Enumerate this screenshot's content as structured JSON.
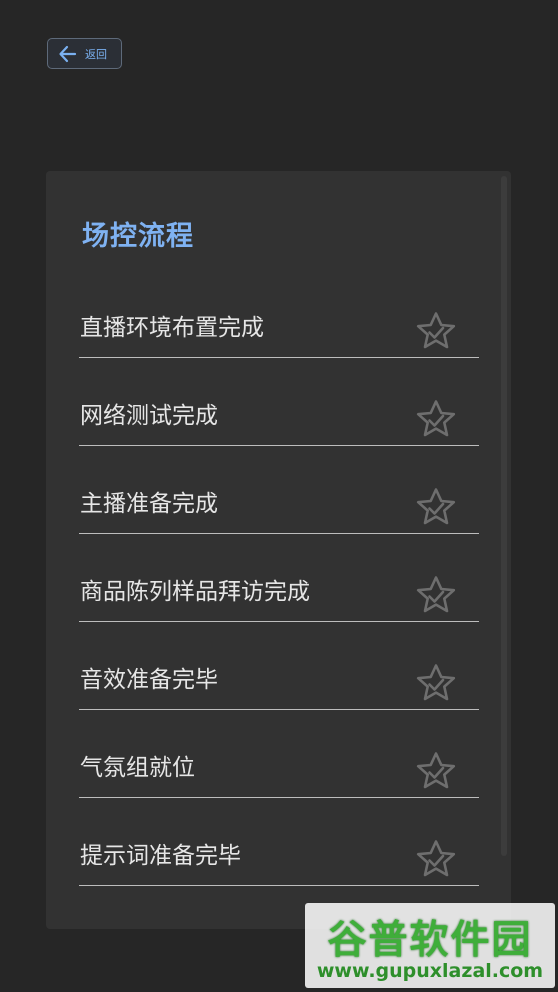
{
  "header": {
    "back_label": "返回"
  },
  "card": {
    "title": "场控流程",
    "items": [
      {
        "label": "直播环境布置完成",
        "checked": false
      },
      {
        "label": "网络测试完成",
        "checked": false
      },
      {
        "label": "主播准备完成",
        "checked": false
      },
      {
        "label": "商品陈列样品拜访完成",
        "checked": false
      },
      {
        "label": "音效准备完毕",
        "checked": false
      },
      {
        "label": "气氛组就位",
        "checked": false
      },
      {
        "label": "提示词准备完毕",
        "checked": false
      }
    ]
  },
  "watermark": {
    "title": "谷普软件园",
    "url": "www.gupuxlazal.com"
  },
  "colors": {
    "background": "#262626",
    "card": "#323232",
    "accent": "#7fb2f2",
    "star_outline": "#6e6e6e"
  },
  "icons": {
    "back": "arrow-left-icon",
    "item_status": "star-check-icon"
  }
}
